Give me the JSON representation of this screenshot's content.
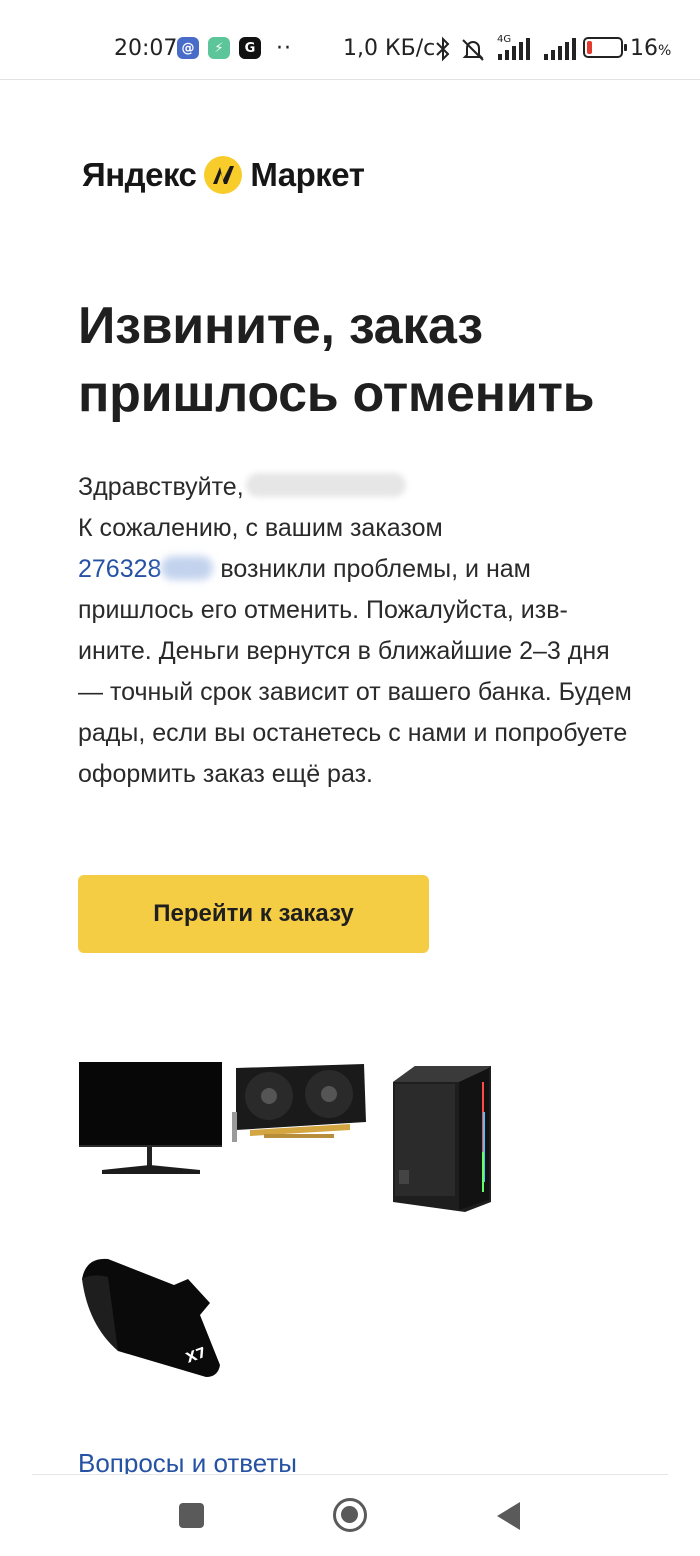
{
  "status_bar": {
    "time": "20:07",
    "app_icons": [
      "mail-icon",
      "shield-icon",
      "g-icon"
    ],
    "more_dots": "··",
    "network_speed": "1,0 КБ/с",
    "network_type": "4G",
    "battery_percent": "16",
    "battery_unit": "%",
    "battery_level": 0.16,
    "battery_color": "#e33b2e"
  },
  "logo": {
    "part1": "Яндекс",
    "part2": "Маркет",
    "accent_color": "#f8cc2a"
  },
  "email": {
    "headline": "Извините, заказ пришлось отменить",
    "greeting": "Здравствуйте,",
    "line1": "К сожалению, с вашим заказом",
    "order_number_visible": "276328",
    "message_rest": "возникли проблемы, и нам пришлось его отменить. Пожалуйста, изв-ините. Деньги вернутся в ближайшие 2–3 дня — точный срок зависит от вашего банка. Будем рады, если вы останетесь с нами и попробуете оформить заказ ещё раз.",
    "button_label": "Перейти к заказу",
    "button_color": "#f5cd45",
    "products": [
      "monitor",
      "graphics-card",
      "pc-case",
      "mouse-pad"
    ],
    "mousepad_brand": "X7",
    "faq_link": "Вопросы и ответы",
    "link_color": "#2552a3"
  },
  "nav_bar": {
    "buttons": [
      "recents-icon",
      "home-icon",
      "back-icon"
    ]
  }
}
